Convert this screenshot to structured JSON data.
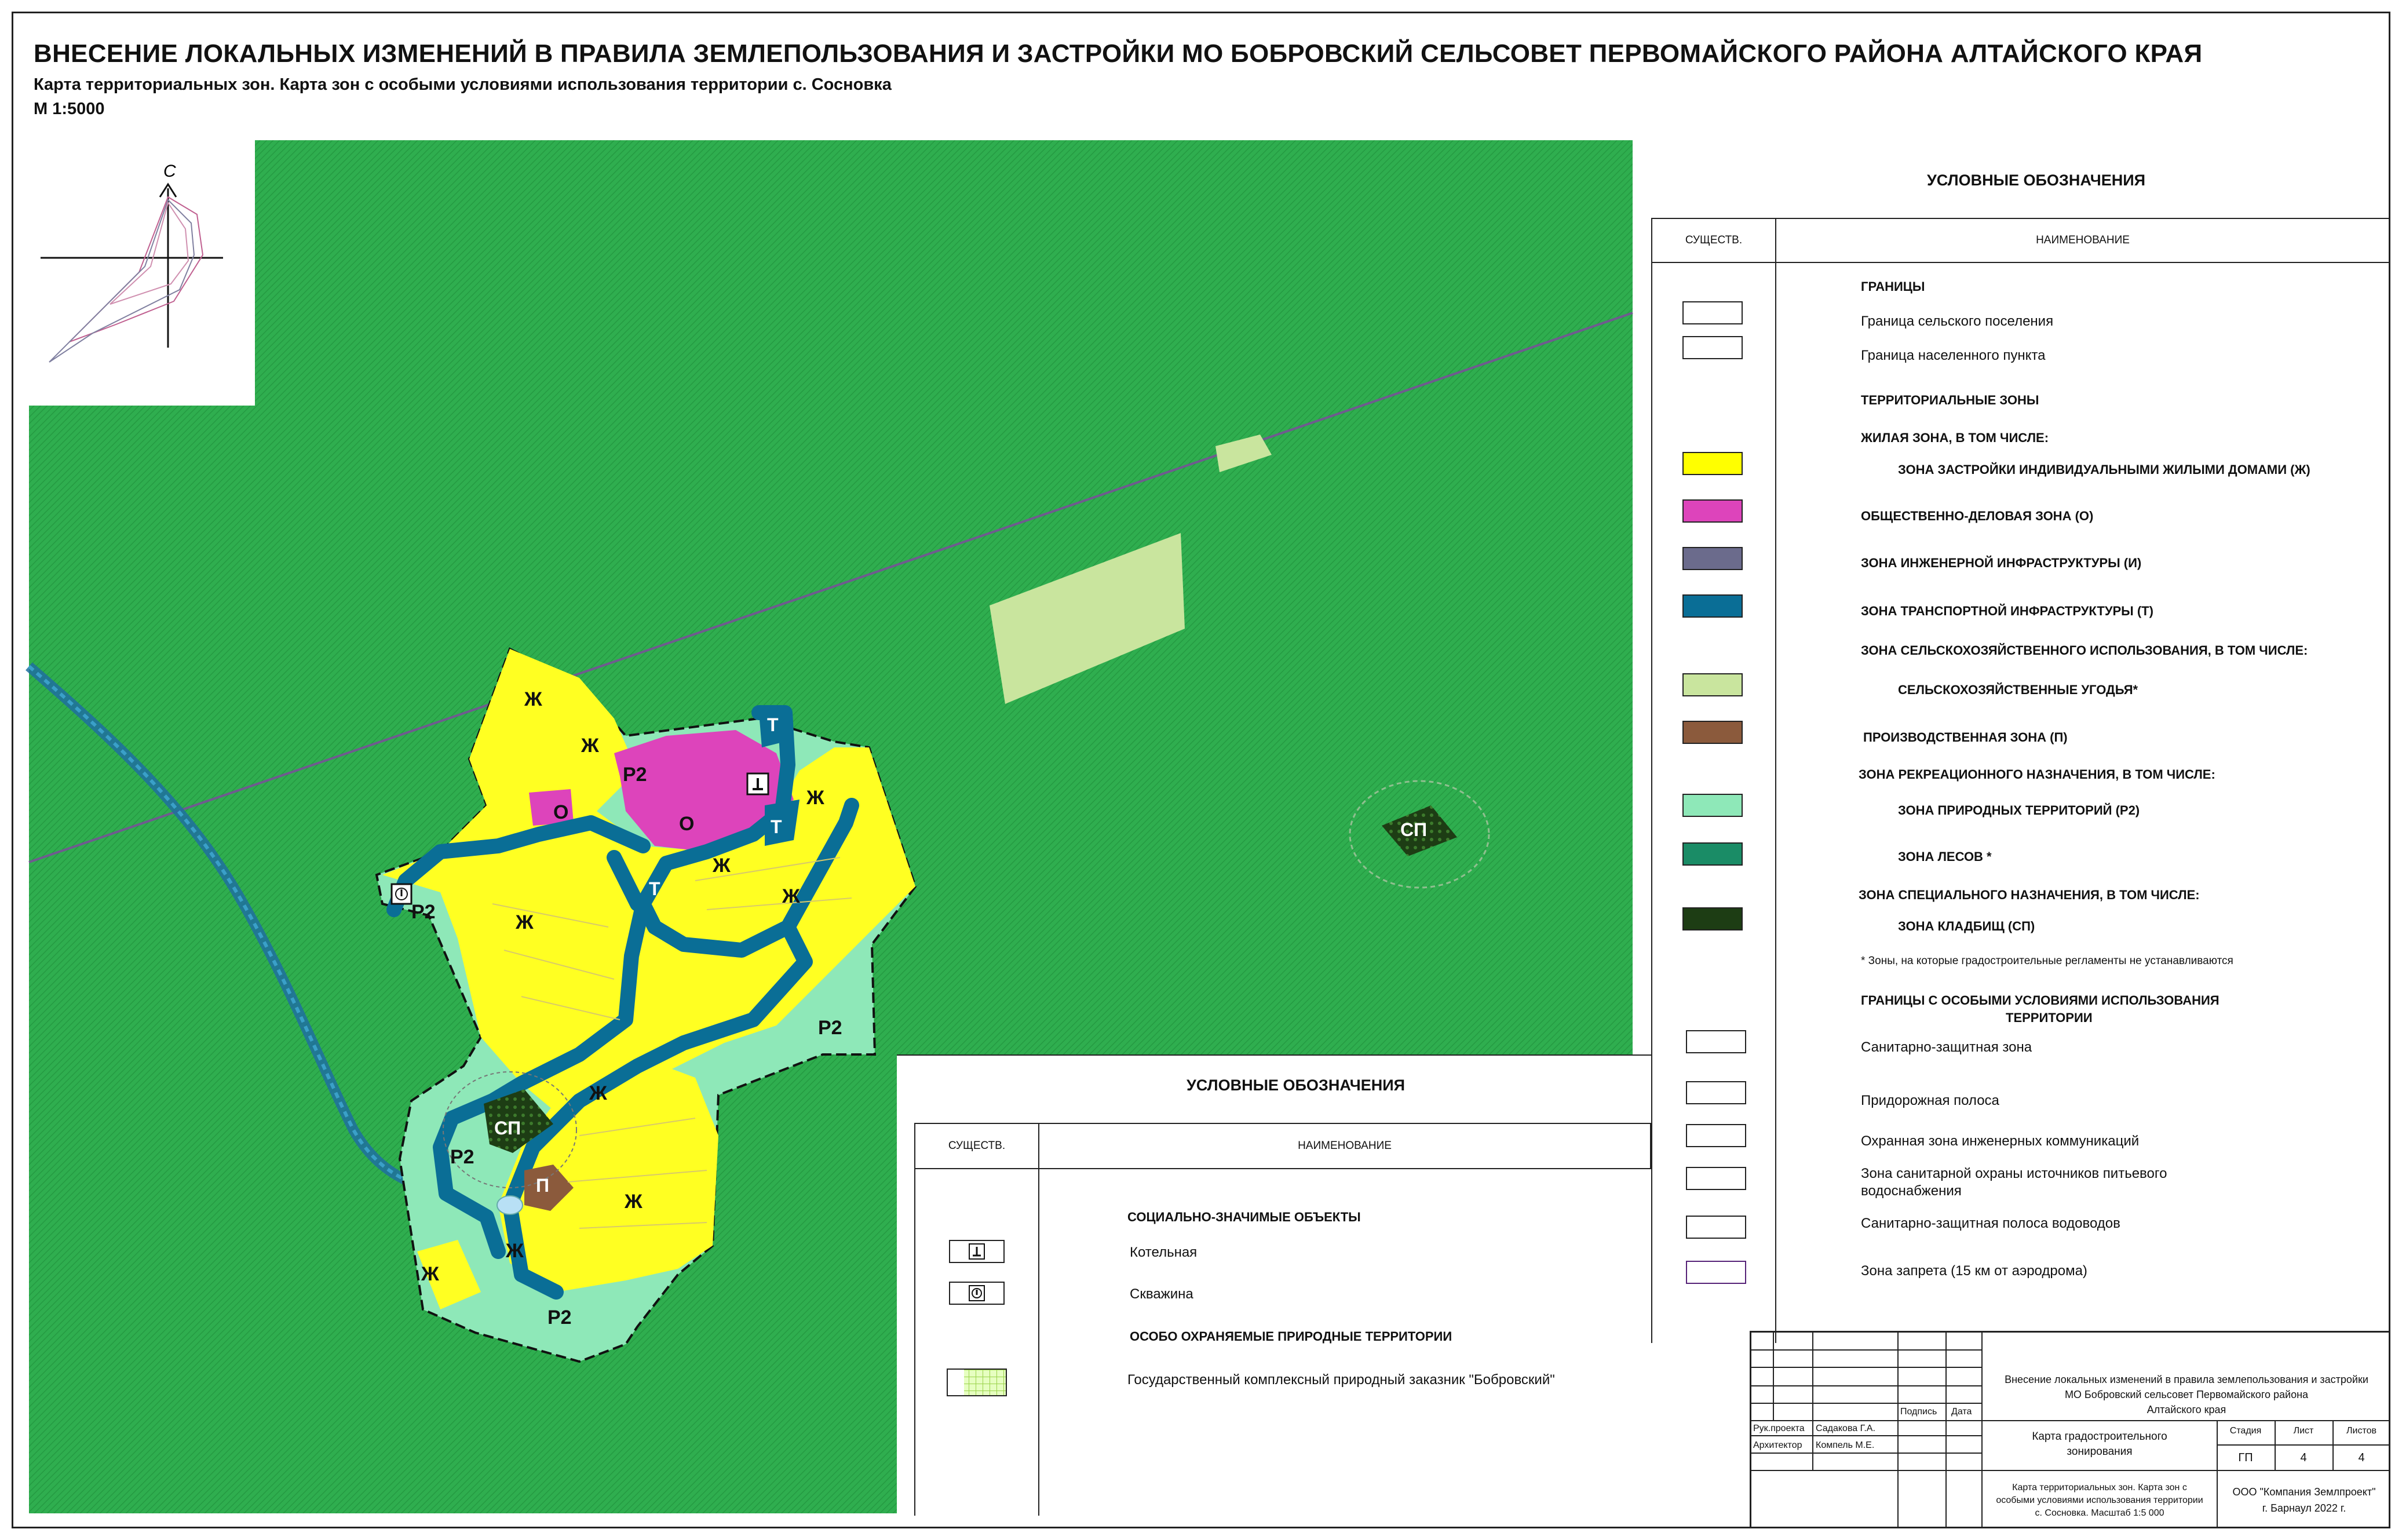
{
  "header": {
    "title": "ВНЕСЕНИЕ ЛОКАЛЬНЫХ ИЗМЕНЕНИЙ В ПРАВИЛА ЗЕМЛЕПОЛЬЗОВАНИЯ И ЗАСТРОЙКИ МО БОБРОВСКИЙ СЕЛЬСОВЕТ ПЕРВОМАЙСКОГО РАЙОНА АЛТАЙСКОГО КРАЯ",
    "subtitle": "Карта территориальных зон. Карта зон с особыми условиями использования территории с. Сосновка",
    "scale": "М 1:5000"
  },
  "compass": {
    "north_label": "С"
  },
  "map": {
    "zone_labels": {
      "zh1": "Ж",
      "zh2": "Ж",
      "zh3": "Ж",
      "zh4": "Ж",
      "zh5": "Ж",
      "zh6": "Ж",
      "zh7": "Ж",
      "zh8": "Ж",
      "zh9": "Ж",
      "o1": "О",
      "o2": "О",
      "t1": "Т",
      "t2": "Т",
      "t3": "Т",
      "r2_1": "Р2",
      "r2_2": "Р2",
      "r2_3": "Р2",
      "r2_4": "Р2",
      "r2_5": "Р2",
      "sp1": "СП",
      "sp2": "СП",
      "p1": "П"
    },
    "colors": {
      "reserve": "#2fae4f",
      "residential": "#ffff00",
      "public": "#dd44bb",
      "transport": "#0a6e96",
      "natural": "#8ee8b8",
      "agricultural": "#c9e59e",
      "industrial": "#8b5a3c",
      "cemetery": "#1d3d14",
      "engineering": "#6b6b8c",
      "forest": "#1a8c66"
    }
  },
  "legend_main": {
    "title": "УСЛОВНЫЕ ОБОЗНАЧЕНИЯ",
    "col_code": "СУЩЕСТВ.",
    "col_name": "НАИМЕНОВАНИЕ",
    "items": {
      "borders": "ГРАНИЦЫ",
      "border_settlement": "Граница сельского поселения",
      "border_locality": "Граница населенного пункта",
      "terr_zones": "ТЕРРИТОРИАЛЬНЫЕ ЗОНЫ",
      "residential": "ЖИЛАЯ ЗОНА, В ТОМ ЧИСЛЕ:",
      "zh": "ЗОНА ЗАСТРОЙКИ ИНДИВИДУАЛЬНЫМИ ЖИЛЫМИ ДОМАМИ (Ж)",
      "o": "ОБЩЕСТВЕННО-ДЕЛОВАЯ ЗОНА (О)",
      "i": "ЗОНА ИНЖЕНЕРНОЙ ИНФРАСТРУКТУРЫ (И)",
      "t": "ЗОНА ТРАНСПОРТНОЙ ИНФРАСТРУКТУРЫ (Т)",
      "agri": "ЗОНА СЕЛЬСКОХОЗЯЙСТВЕННОГО ИСПОЛЬЗОВАНИЯ, В ТОМ ЧИСЛЕ:",
      "agri_land": "СЕЛЬСКОХОЗЯЙСТВЕННЫЕ УГОДЬЯ*",
      "p": "ПРОИЗВОДСТВЕННАЯ ЗОНА (П)",
      "recr": "ЗОНА РЕКРЕАЦИОННОГО НАЗНАЧЕНИЯ, В ТОМ ЧИСЛЕ:",
      "r2": "ЗОНА ПРИРОДНЫХ ТЕРРИТОРИЙ (Р2)",
      "forest": "ЗОНА ЛЕСОВ *",
      "special": "ЗОНА СПЕЦИАЛЬНОГО НАЗНАЧЕНИЯ, В ТОМ ЧИСЛЕ:",
      "sp": "ЗОНА КЛАДБИЩ (СП)",
      "note": "* Зоны, на которые градостроительные регламенты не устанавливаются",
      "special_cond": "ГРАНИЦЫ С ОСОБЫМИ УСЛОВИЯМИ ИСПОЛЬЗОВАНИЯ",
      "special_cond2": "ТЕРРИТОРИИ",
      "szz": "Санитарно-защитная зона",
      "road": "Придорожная полоса",
      "eng": "Охранная зона инженерных коммуникаций",
      "water1": "Зона санитарной охраны источников питьевого",
      "water2": "водоснабжения",
      "pipe": "Санитарно-защитная полоса водоводов",
      "air": "Зона запрета (15 км от аэродрома)"
    }
  },
  "legend_objects": {
    "title": "УСЛОВНЫЕ ОБОЗНАЧЕНИЯ",
    "col_code": "СУЩЕСТВ.",
    "col_name": "НАИМЕНОВАНИЕ",
    "social": "СОЦИАЛЬНО-ЗНАЧИМЫЕ ОБЪЕКТЫ",
    "boiler": "Котельная",
    "well": "Скважина",
    "protected": "ОСОБО ОХРАНЯЕМЫЕ ПРИРОДНЫЕ ТЕРРИТОРИИ",
    "reserve": "Государственный комплексный природный заказник \"Бобровский\""
  },
  "title_block": {
    "project1": "Внесение локальных изменений в правила землепользования и застройки",
    "project2": "МО Бобровский сельсовет Первомайского района",
    "project3": "Алтайского края",
    "sign": "Подпись",
    "date": "Дата",
    "role1": "Рук.проекта",
    "name1": "Садакова Г.А.",
    "role2": "Архитектор",
    "name2": "Компель М.Е.",
    "drawing1": "Карта градостроительного",
    "drawing2": "зонирования",
    "stage_h": "Стадия",
    "sheet_h": "Лист",
    "sheets_h": "Листов",
    "stage": "ГП",
    "sheet": "4",
    "sheets": "4",
    "desc1": "Карта территориальных зон. Карта зон с",
    "desc2": "особыми условиями использования территории",
    "desc3": "с. Сосновка. Масштаб 1:5 000",
    "company1": "ООО \"Компания Землпроект\"",
    "company2": "г. Барнаул 2022 г."
  }
}
